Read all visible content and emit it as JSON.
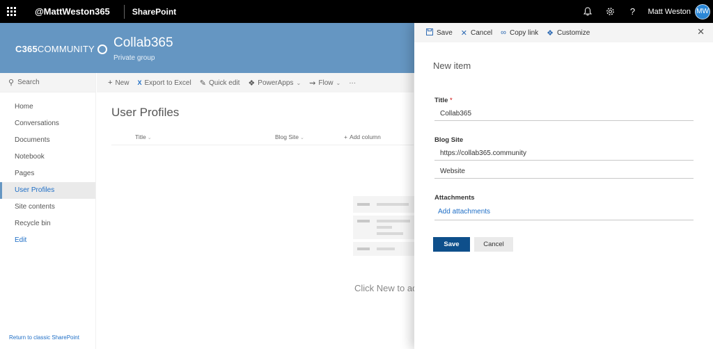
{
  "suitebar": {
    "tenant": "@MattWeston365",
    "app": "SharePoint",
    "user_name": "Matt Weston",
    "user_initials": "MW",
    "icons": [
      "waffle-icon",
      "bell-icon",
      "gear-icon",
      "help-icon"
    ]
  },
  "site": {
    "logo_prefix": "C365",
    "logo_text": "COMMUNITY",
    "title": "Collab365",
    "subtitle": "Private group"
  },
  "search": {
    "placeholder": "Search"
  },
  "nav": {
    "items": [
      "Home",
      "Conversations",
      "Documents",
      "Notebook",
      "Pages",
      "User Profiles",
      "Site contents",
      "Recycle bin",
      "Edit"
    ],
    "active": "User Profiles",
    "classic_link": "Return to classic SharePoint"
  },
  "commandbar": {
    "new": "New",
    "export": "Export to Excel",
    "quick_edit": "Quick edit",
    "powerapps": "PowerApps",
    "flow": "Flow",
    "more": "···"
  },
  "list": {
    "title": "User Profiles",
    "columns": [
      "Title",
      "Blog Site",
      "Add column"
    ],
    "empty_text": "Click New to add"
  },
  "panel": {
    "toolbar": {
      "save": "Save",
      "cancel": "Cancel",
      "copy_link": "Copy link",
      "customize": "Customize"
    },
    "heading": "New item",
    "title_label": "Title",
    "required_mark": "*",
    "title_value": "Collab365",
    "blog_label": "Blog Site",
    "blog_url": "https://collab365.community",
    "blog_desc": "Website",
    "attachments_label": "Attachments",
    "add_attachments": "Add attachments",
    "save_button": "Save",
    "cancel_button": "Cancel"
  },
  "colors": {
    "site_header": "#6596c2",
    "primary_button": "#0e4f8b",
    "link": "#1e6ec6",
    "suitebar": "#000000"
  }
}
